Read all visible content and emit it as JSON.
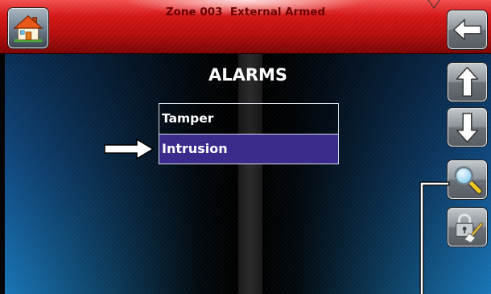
{
  "header": {
    "title": "Zone 003  External Armed",
    "home_icon": "home-icon"
  },
  "screen": {
    "title": "ALARMS"
  },
  "alarm_list": {
    "items": [
      {
        "label": "Tamper",
        "selected": false
      },
      {
        "label": "Intrusion",
        "selected": true
      }
    ]
  },
  "side_buttons": [
    {
      "icon": "arrow-left-icon"
    },
    {
      "icon": "arrow-up-icon"
    },
    {
      "icon": "arrow-down-icon"
    },
    {
      "icon": "magnifier-icon"
    },
    {
      "icon": "lock-broom-icon"
    }
  ],
  "annotations": {
    "pointer_icon": "right-arrow-pointer-icon"
  },
  "colors": {
    "header_red": "#d41616",
    "header_text": "#6b0000",
    "selected_row": "#3b2b8d",
    "accent_blue": "#1b86d0",
    "button_gray": "#8b9197"
  }
}
